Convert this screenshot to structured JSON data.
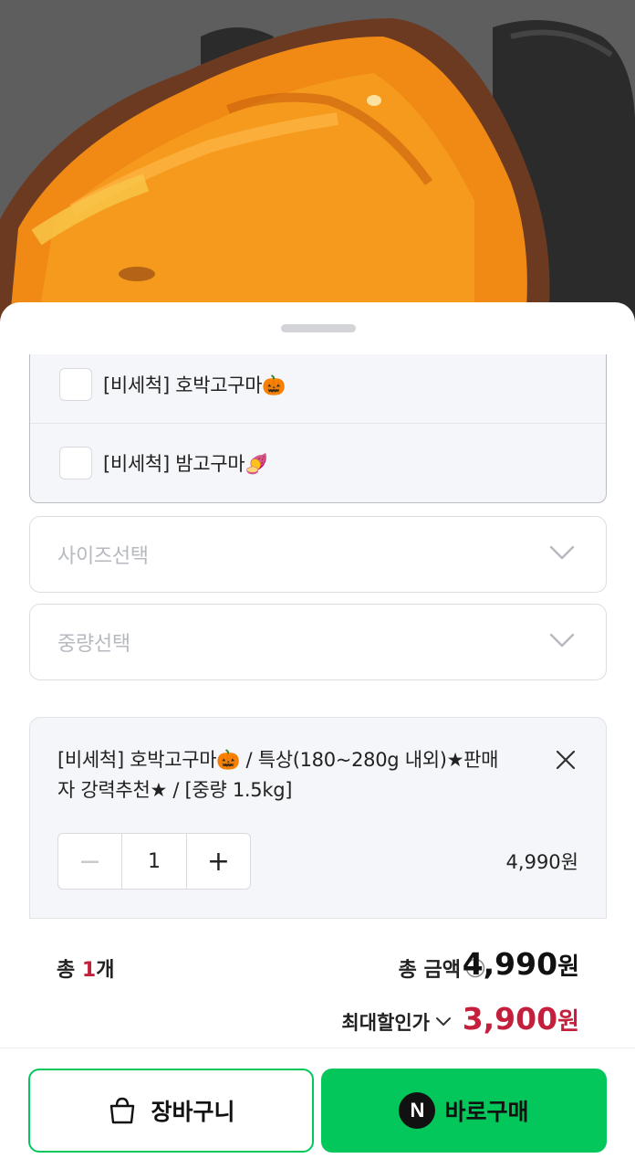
{
  "options": {
    "items": [
      {
        "label": "[비세척] 호박고구마🎃"
      },
      {
        "label": "[비세척] 밤고구마🍠"
      }
    ]
  },
  "selects": {
    "size_placeholder": "사이즈선택",
    "weight_placeholder": "중량선택"
  },
  "selected_item": {
    "title": "[비세척] 호박고구마🎃 / 특상(180~280g 내외)★판매자 강력추천★ / [중량 1.5kg]",
    "minus": "−",
    "quantity": "1",
    "plus": "+",
    "price": "4,990원"
  },
  "totals": {
    "count_prefix": "총 ",
    "count_value": "1",
    "count_suffix": "개",
    "amount_label": "총 금액",
    "amount_value": "4,990",
    "amount_unit": "원",
    "discount_label": "최대할인가",
    "discount_value": "3,900",
    "discount_unit": "원"
  },
  "actions": {
    "cart_label": "장바구니",
    "buy_icon_letter": "N",
    "buy_label": "바로구매"
  },
  "colors": {
    "brand_green": "#03c75a",
    "accent_red": "#c4203d"
  }
}
